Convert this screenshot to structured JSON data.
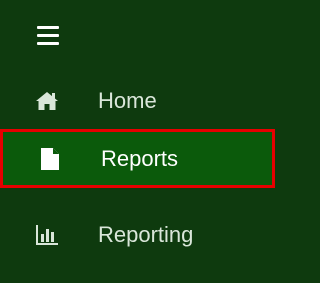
{
  "sidebar": {
    "menu_icon": "hamburger-menu-icon",
    "items": [
      {
        "icon": "home-icon",
        "label": "Home",
        "active": false
      },
      {
        "icon": "report-document-icon",
        "label": "Reports",
        "active": true
      },
      {
        "icon": "bar-chart-icon",
        "label": "Reporting",
        "active": false
      }
    ]
  },
  "colors": {
    "background": "#0e3a0e",
    "active_background": "#0b5a0b",
    "highlight_border": "#e60000",
    "text": "#d9e6d9",
    "active_text": "#ffffff"
  }
}
